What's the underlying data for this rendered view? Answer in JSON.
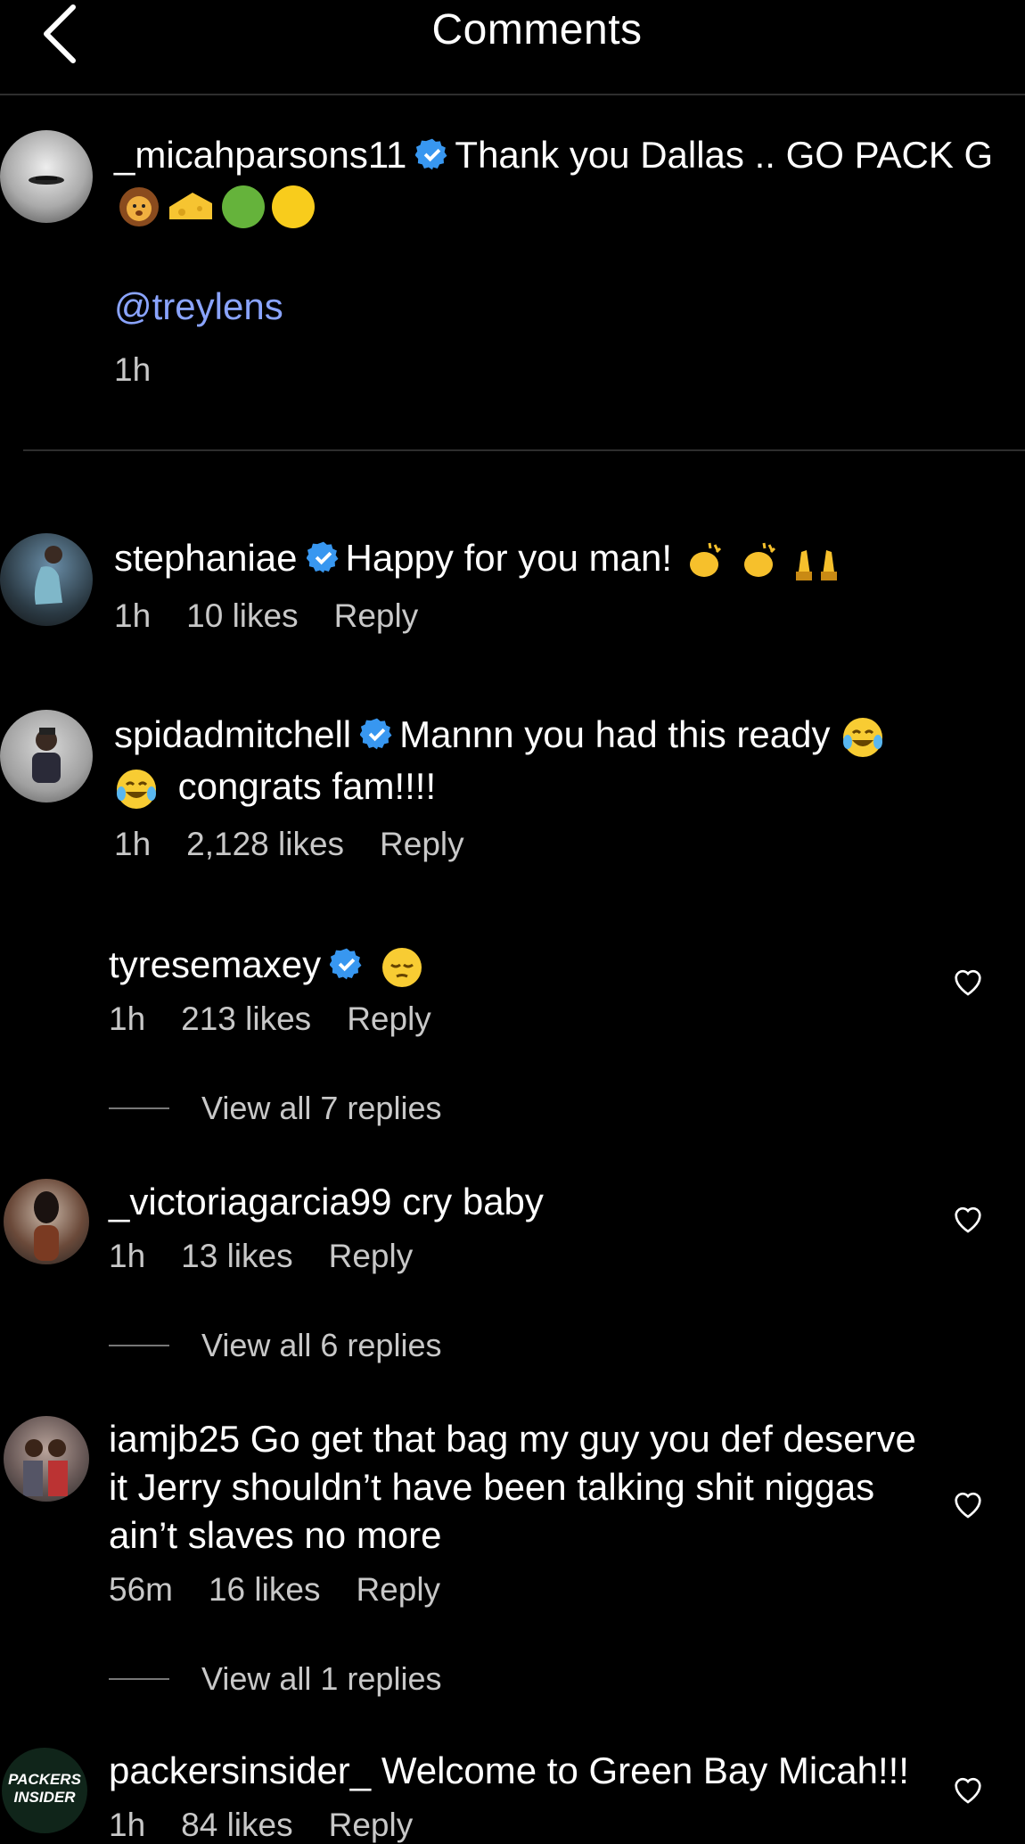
{
  "header": {
    "title": "Comments"
  },
  "post": {
    "username": "_micahparsons11",
    "caption": "Thank you Dallas .. GO PACK G",
    "emoji_line": [
      "lion-emoji",
      "cheese-emoji",
      "green-circle-emoji",
      "yellow-circle-emoji"
    ],
    "mention": "@treylens",
    "time": "1h"
  },
  "comments": [
    {
      "username": "stephaniae",
      "verified": true,
      "text": "Happy for you man!",
      "emojis": [
        "clapping-hands-emoji",
        "clapping-hands-emoji",
        "raising-hands-emoji"
      ],
      "time": "1h",
      "likes": "10 likes",
      "reply": "Reply"
    },
    {
      "username": "spidadmitchell",
      "verified": true,
      "text": "Mannn you had this ready",
      "text2": "congrats fam!!!!",
      "time": "1h",
      "likes": "2,128 likes",
      "reply": "Reply"
    },
    {
      "username": "tyresemaxey",
      "verified": true,
      "text": "",
      "emojis": [
        "pensive-face-emoji"
      ],
      "time": "1h",
      "likes": "213 likes",
      "reply": "Reply",
      "view_replies": "View all 7 replies"
    },
    {
      "username": "_victoriagarcia99",
      "verified": false,
      "text": "cry baby",
      "time": "1h",
      "likes": "13 likes",
      "reply": "Reply",
      "view_replies": "View all 6 replies"
    },
    {
      "username": "iamjb25",
      "verified": false,
      "text": "Go get that bag my guy you def deserve",
      "text2": "it Jerry shouldn’t have been talking shit niggas",
      "text3": "ain’t slaves no more",
      "time": "56m",
      "likes": "16 likes",
      "reply": "Reply",
      "view_replies": "View all 1 replies"
    },
    {
      "username": "packersinsider_",
      "verified": false,
      "text": "Welcome to Green Bay Micah!!!",
      "time": "1h",
      "likes": "84 likes",
      "reply": "Reply",
      "avatar_text_top": "PACKERS",
      "avatar_text_bottom": "INSIDER"
    }
  ],
  "colors": {
    "background": "#000000",
    "verified": "#3897f0",
    "mention": "#8aa4ff",
    "meta": "#c8c8c8"
  }
}
